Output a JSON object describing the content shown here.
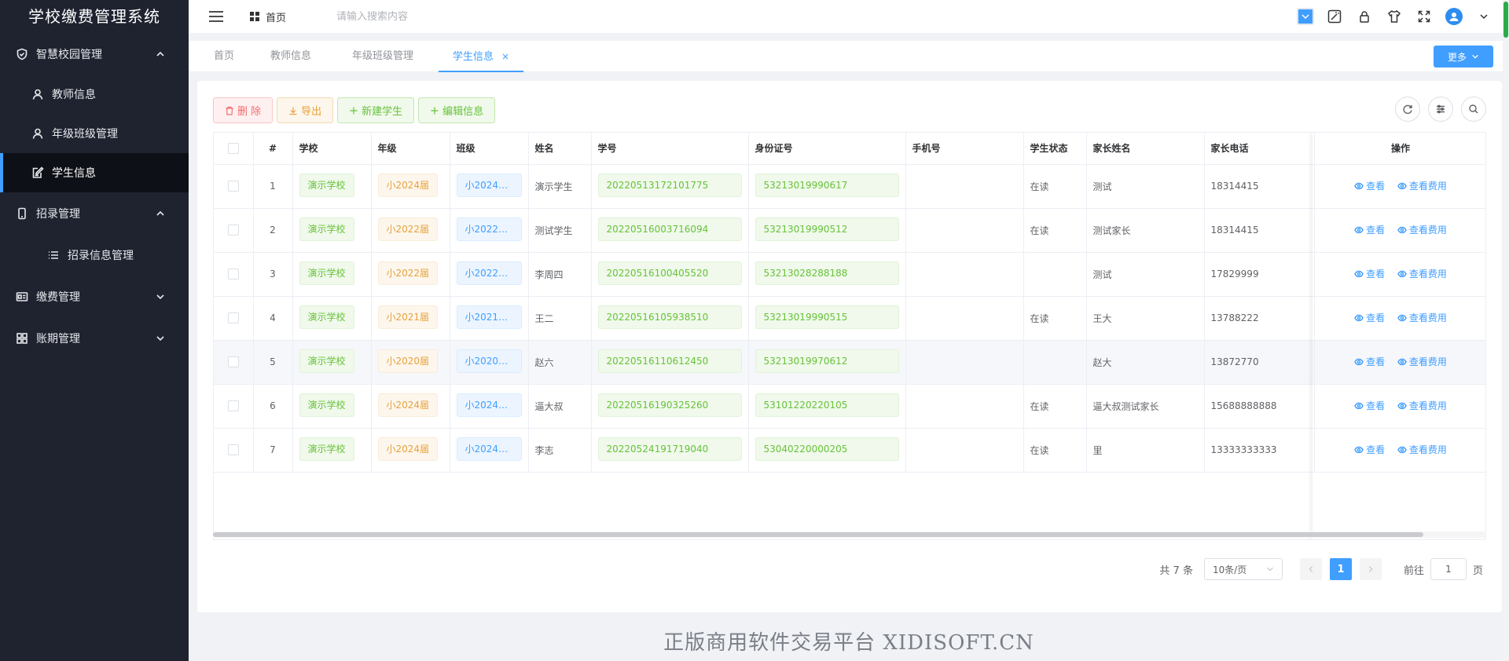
{
  "app": {
    "title": "学校缴费管理系统"
  },
  "sidebar": {
    "items": [
      {
        "label": "智慧校园管理",
        "icon": "shield-check-icon"
      },
      {
        "label": "教师信息",
        "icon": "user-icon"
      },
      {
        "label": "年级班级管理",
        "icon": "user-icon"
      },
      {
        "label": "学生信息",
        "icon": "edit-doc-icon",
        "active": true
      },
      {
        "label": "招录管理",
        "icon": "phone-icon"
      },
      {
        "label": "招录信息管理",
        "icon": "list-icon"
      },
      {
        "label": "缴费管理",
        "icon": "id-card-icon"
      },
      {
        "label": "账期管理",
        "icon": "grid-icon"
      }
    ]
  },
  "header": {
    "home_label": "首页",
    "search_placeholder": "请输入搜索内容"
  },
  "tabs": [
    {
      "label": "首页"
    },
    {
      "label": "教师信息"
    },
    {
      "label": "年级班级管理"
    },
    {
      "label": "学生信息",
      "active": true,
      "close": "×"
    }
  ],
  "more_button": "更多",
  "toolbar": {
    "delete": "删 除",
    "export": "导出",
    "new_student": "新建学生",
    "edit_info": "编辑信息"
  },
  "table": {
    "columns": [
      "#",
      "学校",
      "年级",
      "班级",
      "姓名",
      "学号",
      "身份证号",
      "手机号",
      "学生状态",
      "家长姓名",
      "家长电话",
      "操作"
    ],
    "view_label": "查看",
    "view_fee_label": "查看费用",
    "rows": [
      {
        "no": "1",
        "school": "演示学校",
        "grade": "小2024届",
        "class": "小2024届...",
        "name": "演示学生",
        "student_id": "20220513172101775",
        "id_card": "53213019990617",
        "phone": "",
        "status": "在读",
        "parent_name": "测试",
        "parent_phone": "18314415"
      },
      {
        "no": "2",
        "school": "演示学校",
        "grade": "小2022届",
        "class": "小2022届...",
        "name": "测试学生",
        "student_id": "20220516003716094",
        "id_card": "53213019990512",
        "phone": "",
        "status": "在读",
        "parent_name": "测试家长",
        "parent_phone": "18314415"
      },
      {
        "no": "3",
        "school": "演示学校",
        "grade": "小2022届",
        "class": "小2022届...",
        "name": "李周四",
        "student_id": "20220516100405520",
        "id_card": "53213028288188",
        "phone": "",
        "status": "",
        "parent_name": "测试",
        "parent_phone": "17829999"
      },
      {
        "no": "4",
        "school": "演示学校",
        "grade": "小2021届",
        "class": "小2021届...",
        "name": "王二",
        "student_id": "20220516105938510",
        "id_card": "53213019990515",
        "phone": "",
        "status": "在读",
        "parent_name": "王大",
        "parent_phone": "13788222"
      },
      {
        "no": "5",
        "school": "演示学校",
        "grade": "小2020届",
        "class": "小2020届...",
        "name": "赵六",
        "student_id": "20220516110612450",
        "id_card": "53213019970612",
        "phone": "",
        "status": "",
        "parent_name": "赵大",
        "parent_phone": "13872770"
      },
      {
        "no": "6",
        "school": "演示学校",
        "grade": "小2024届",
        "class": "小2024届...",
        "name": "逼大叔",
        "student_id": "20220516190325260",
        "id_card": "53101220220105",
        "phone": "",
        "status": "在读",
        "parent_name": "逼大叔测试家长",
        "parent_phone": "15688888888"
      },
      {
        "no": "7",
        "school": "演示学校",
        "grade": "小2024届",
        "class": "小2024届...",
        "name": "李志",
        "student_id": "20220524191719040",
        "id_card": "53040220000205",
        "phone": "",
        "status": "在读",
        "parent_name": "里",
        "parent_phone": "13333333333"
      }
    ]
  },
  "pagination": {
    "total": "共 7 条",
    "page_size": "10条/页",
    "current_page": "1",
    "goto_prefix": "前往",
    "goto_value": "1",
    "goto_suffix": "页"
  },
  "watermark": "正版商用软件交易平台 XIDISOFT.CN",
  "colors": {
    "sidebar_bg": "#1f2330",
    "primary": "#409eff",
    "success": "#67c23a",
    "warning": "#e6a23c",
    "danger": "#f56c6c"
  }
}
